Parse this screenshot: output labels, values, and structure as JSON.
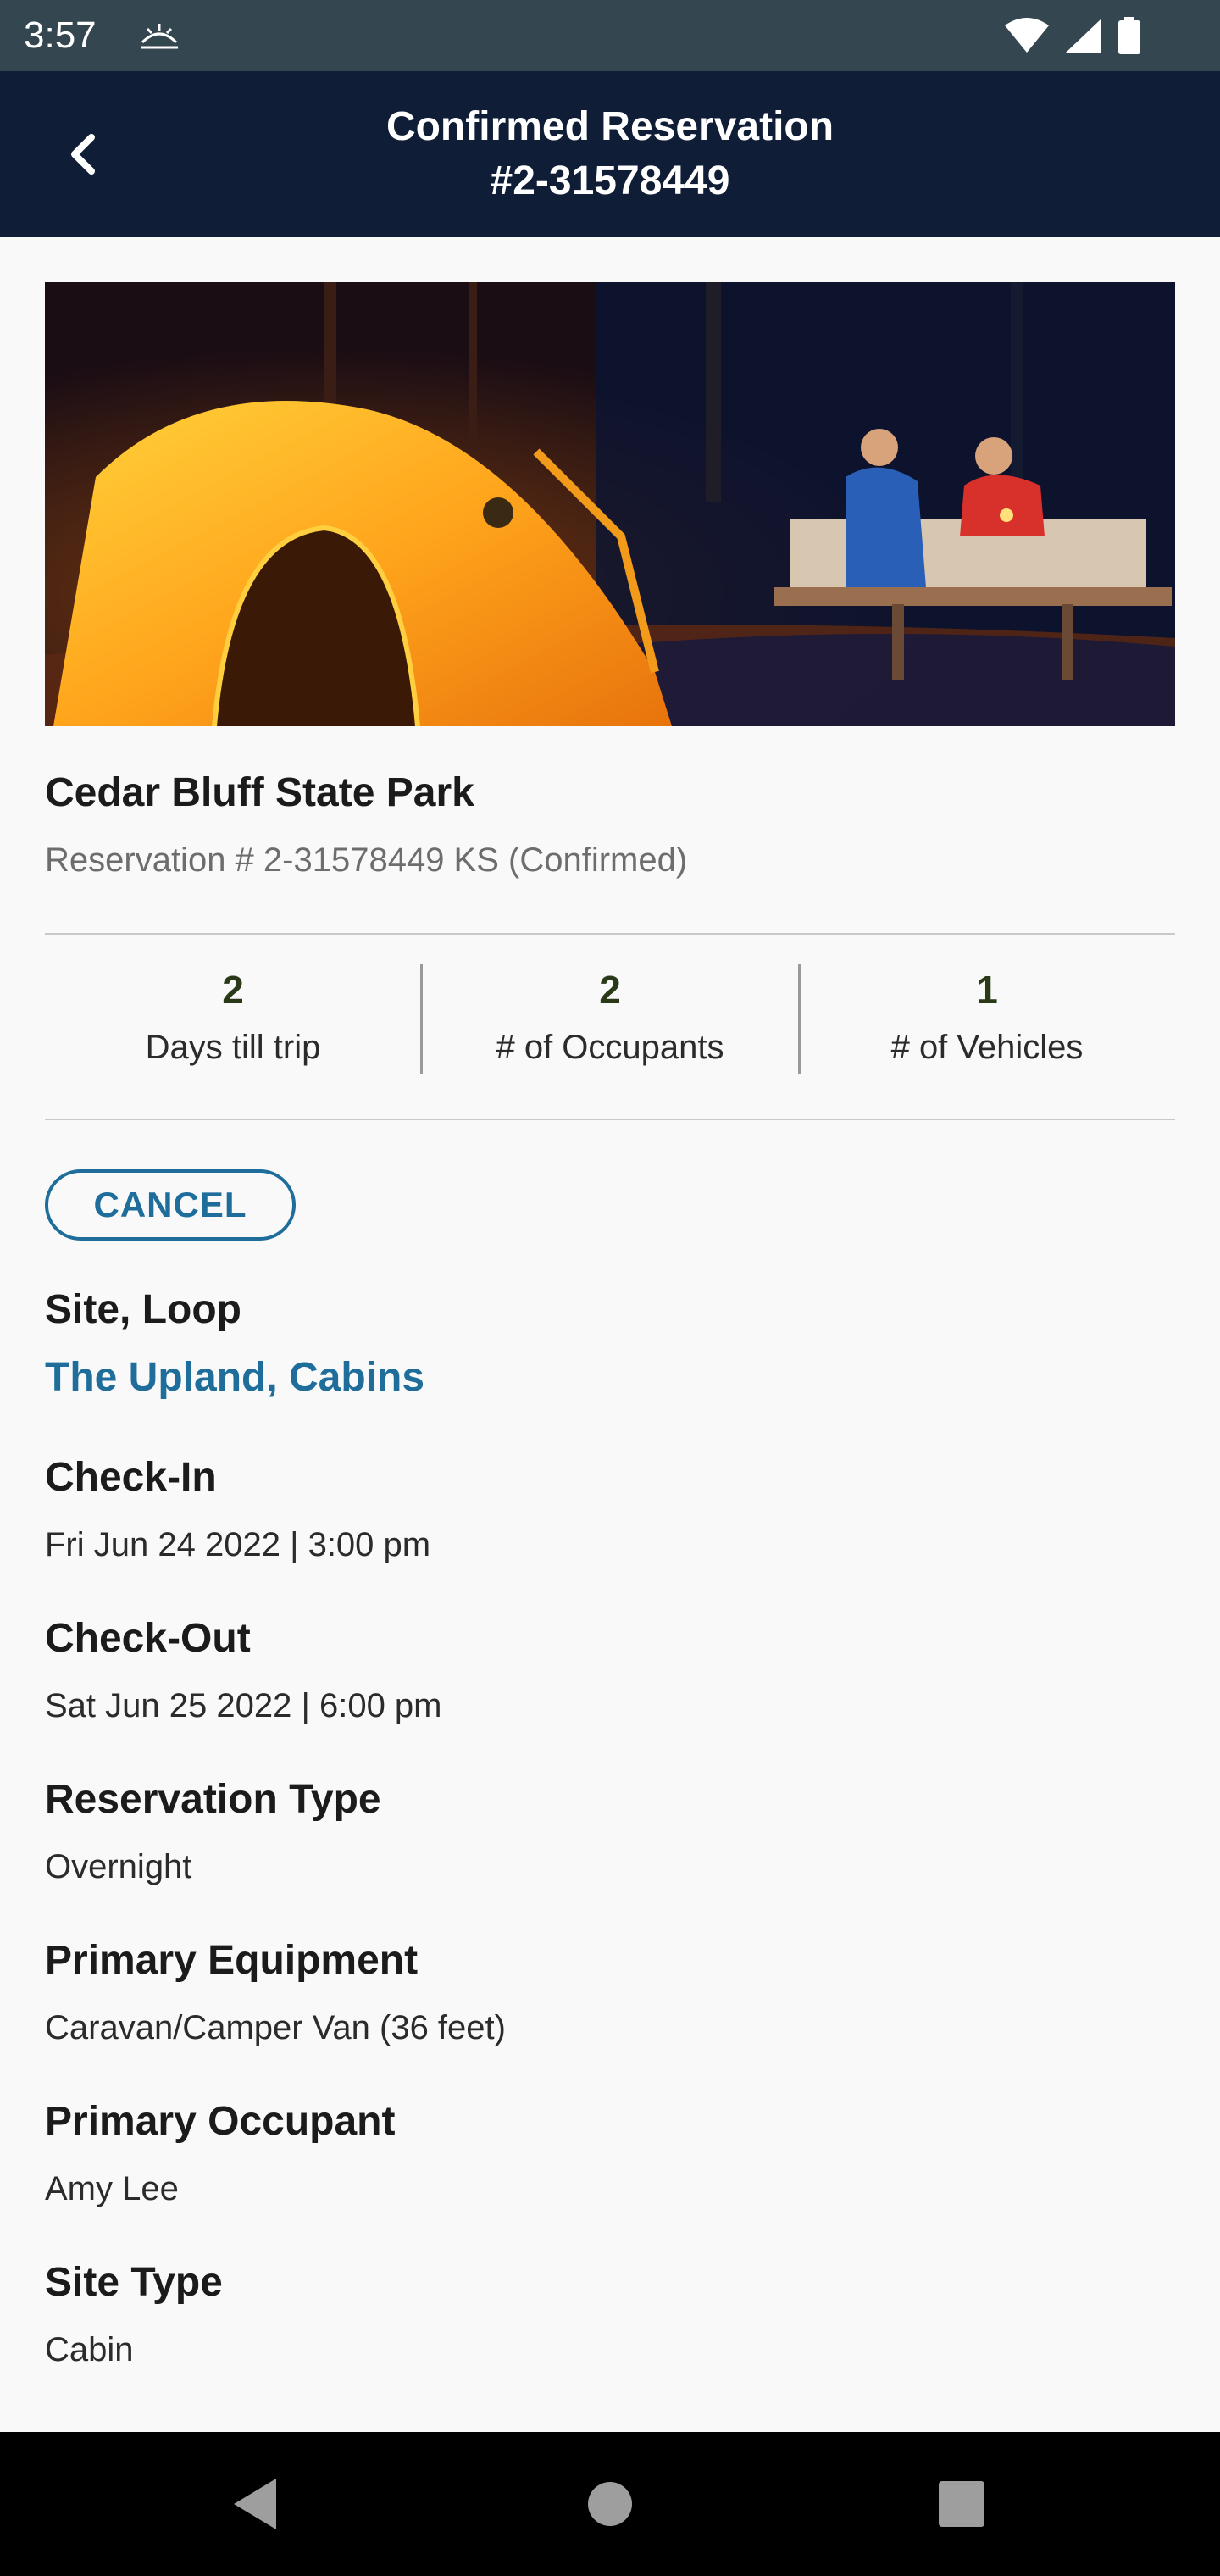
{
  "status_bar": {
    "time": "3:57"
  },
  "header": {
    "title_line1": "Confirmed Reservation",
    "title_line2": "#2-31578449"
  },
  "park": {
    "name": "Cedar Bluff State Park",
    "reservation_line": "Reservation # 2-31578449 KS (Confirmed)"
  },
  "stats": [
    {
      "value": "2",
      "label": "Days till trip"
    },
    {
      "value": "2",
      "label": "# of Occupants"
    },
    {
      "value": "1",
      "label": "# of Vehicles"
    }
  ],
  "cancel_label": "CANCEL",
  "details": {
    "site_loop": {
      "label": "Site, Loop",
      "value": "The Upland, Cabins"
    },
    "check_in": {
      "label": "Check-In",
      "value": "Fri Jun 24 2022 | 3:00 pm"
    },
    "check_out": {
      "label": "Check-Out",
      "value": "Sat Jun 25 2022 | 6:00 pm"
    },
    "reservation_type": {
      "label": "Reservation Type",
      "value": "Overnight"
    },
    "primary_equipment": {
      "label": "Primary Equipment",
      "value": "Caravan/Camper Van (36 feet)"
    },
    "primary_occupant": {
      "label": "Primary Occupant",
      "value": "Amy Lee"
    },
    "site_type": {
      "label": "Site Type",
      "value": "Cabin"
    }
  },
  "colors": {
    "header_bg": "#0f1d37",
    "status_bg": "#34464f",
    "accent": "#1f6d9a",
    "stat_value": "#2a3a19"
  }
}
